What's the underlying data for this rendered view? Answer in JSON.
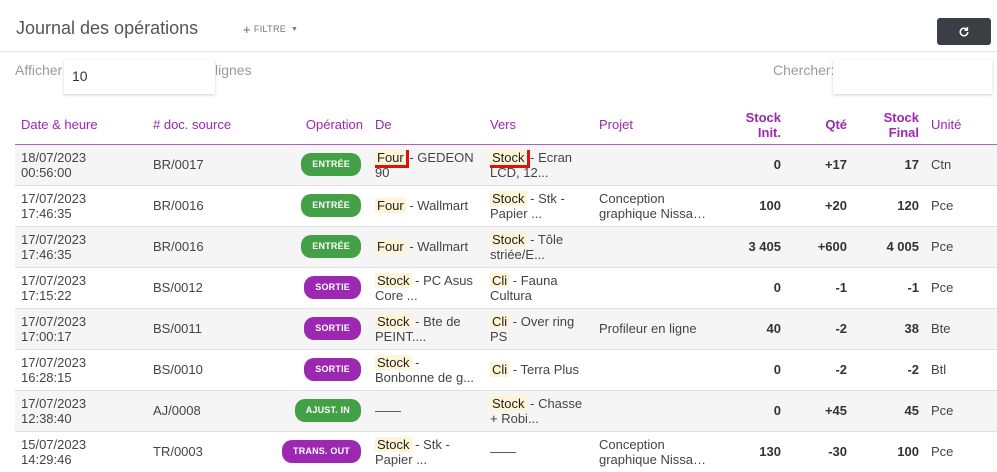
{
  "header": {
    "title": "Journal des opérations",
    "filter_label": "FILTRE"
  },
  "controls": {
    "show_prefix": "Afficher",
    "page_length": "10",
    "show_suffix": "lignes",
    "search_label": "Chercher:"
  },
  "columns": {
    "date": "Date & heure",
    "doc": "# doc. source",
    "operation": "Opération",
    "from": "De",
    "to": "Vers",
    "project": "Projet",
    "stock_init": "Stock Init.",
    "qty": "Qté",
    "stock_final_1": "Stock",
    "stock_final_2": "Final",
    "unit": "Unité"
  },
  "rows": [
    {
      "date": "18/07/2023",
      "time": "00:56:00",
      "doc": "BR/0017",
      "operation": "ENTRÉE",
      "op_type": "entree",
      "from_tag": "Four",
      "from_text": " - GEDEON 90",
      "to_tag": "Stock",
      "to_text": " - Ecran LCD, 12...",
      "project": "",
      "stock_init": "0",
      "qty": "+17",
      "stock_final": "17",
      "unit": "Ctn"
    },
    {
      "date": "17/07/2023",
      "time": "17:46:35",
      "doc": "BR/0016",
      "operation": "ENTRÉE",
      "op_type": "entree",
      "from_tag": "Four",
      "from_text": " - Wallmart",
      "to_tag": "Stock",
      "to_text": " - Stk - Papier ...",
      "project": "Conception graphique Nissan +",
      "stock_init": "100",
      "qty": "+20",
      "stock_final": "120",
      "unit": "Pce"
    },
    {
      "date": "17/07/2023",
      "time": "17:46:35",
      "doc": "BR/0016",
      "operation": "ENTRÉE",
      "op_type": "entree",
      "from_tag": "Four",
      "from_text": " - Wallmart",
      "to_tag": "Stock",
      "to_text": " - Tôle striée/E...",
      "project": "",
      "stock_init": "3 405",
      "qty": "+600",
      "stock_final": "4 005",
      "unit": "Pce"
    },
    {
      "date": "17/07/2023",
      "time": "17:15:22",
      "doc": "BS/0012",
      "operation": "SORTIE",
      "op_type": "sortie",
      "from_tag": "Stock",
      "from_text": " - PC Asus Core ...",
      "to_tag": "Cli",
      "to_text": " - Fauna Cultura",
      "project": "",
      "stock_init": "0",
      "qty": "-1",
      "stock_final": "-1",
      "unit": "Pce"
    },
    {
      "date": "17/07/2023",
      "time": "17:00:17",
      "doc": "BS/0011",
      "operation": "SORTIE",
      "op_type": "sortie",
      "from_tag": "Stock",
      "from_text": " - Bte de PEINT....",
      "to_tag": "Cli",
      "to_text": " - Over ring PS",
      "project": "Profileur en ligne",
      "stock_init": "40",
      "qty": "-2",
      "stock_final": "38",
      "unit": "Bte"
    },
    {
      "date": "17/07/2023",
      "time": "16:28:15",
      "doc": "BS/0010",
      "operation": "SORTIE",
      "op_type": "sortie",
      "from_tag": "Stock",
      "from_text": " - Bonbonne de g...",
      "to_tag": "Cli",
      "to_text": " - Terra Plus",
      "project": "",
      "stock_init": "0",
      "qty": "-2",
      "stock_final": "-2",
      "unit": "Btl"
    },
    {
      "date": "17/07/2023",
      "time": "12:38:40",
      "doc": "AJ/0008",
      "operation": "AJUST. IN",
      "op_type": "ajust",
      "from_tag": "",
      "from_text": "——",
      "to_tag": "Stock",
      "to_text": " - Chasse + Robi...",
      "project": "",
      "stock_init": "0",
      "qty": "+45",
      "stock_final": "45",
      "unit": "Pce"
    },
    {
      "date": "15/07/2023",
      "time": "14:29:46",
      "doc": "TR/0003",
      "operation": "TRANS. OUT",
      "op_type": "trans",
      "from_tag": "Stock",
      "from_text": " - Stk - Papier ...",
      "to_tag": "",
      "to_text": "——",
      "project": "Conception graphique Nissan +",
      "stock_init": "130",
      "qty": "-30",
      "stock_final": "100",
      "unit": "Pce"
    }
  ],
  "colors": {
    "accent": "#9c27b0",
    "entree": "#43a047",
    "highlight_tag": "#fff4d6",
    "annotation_box": "#e01010"
  },
  "icons": {
    "refresh": "refresh-icon",
    "filter_plus": "plus-icon",
    "filter_caret": "caret-down-icon"
  }
}
